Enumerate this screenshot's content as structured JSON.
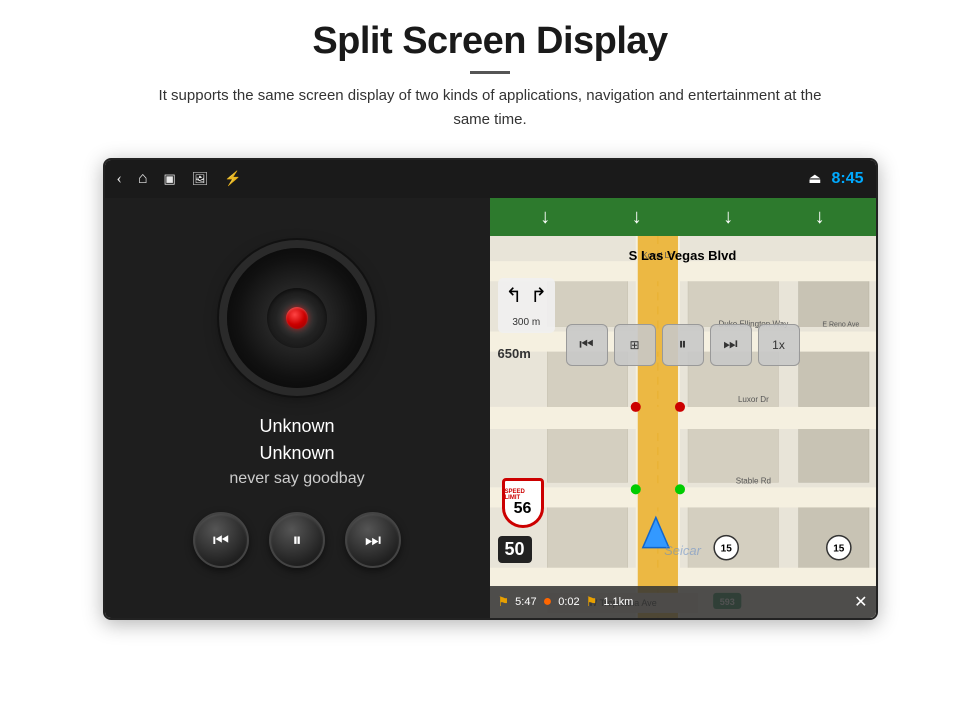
{
  "page": {
    "title": "Split Screen Display",
    "divider": "—",
    "subtitle": "It supports the same screen display of two kinds of applications, navigation and entertainment at the same time."
  },
  "status_bar": {
    "back_icon": "‹",
    "home_icon": "⌂",
    "recent_icon": "▣",
    "image_icon": "🖼",
    "usb_icon": "⚡",
    "eject_icon": "⏏",
    "time": "8:45"
  },
  "music_panel": {
    "track_title": "Unknown",
    "track_artist": "Unknown",
    "track_album": "never say goodbay",
    "prev_label": "⏮",
    "play_label": "⏸",
    "next_label": "⏭"
  },
  "nav_panel": {
    "top_arrows": [
      "↓",
      "↓",
      "↓",
      "↓"
    ],
    "street_label": "S Las Vegas Blvd",
    "turn_arrow_left": "↰",
    "turn_arrow_right": "↱",
    "distance_top": "300 m",
    "distance_left": "650m",
    "speed_limit_label": "SPEED LIMIT",
    "speed_limit_num": "56",
    "speed_sign_50": "50",
    "nav_controls": [
      "⏮",
      "☰",
      "⏸",
      "⏭",
      "1x"
    ],
    "bottom_time": "5:47",
    "bottom_duration": "0:02",
    "bottom_distance": "1.1km",
    "close_btn": "✕",
    "watermark": "Seicar"
  }
}
